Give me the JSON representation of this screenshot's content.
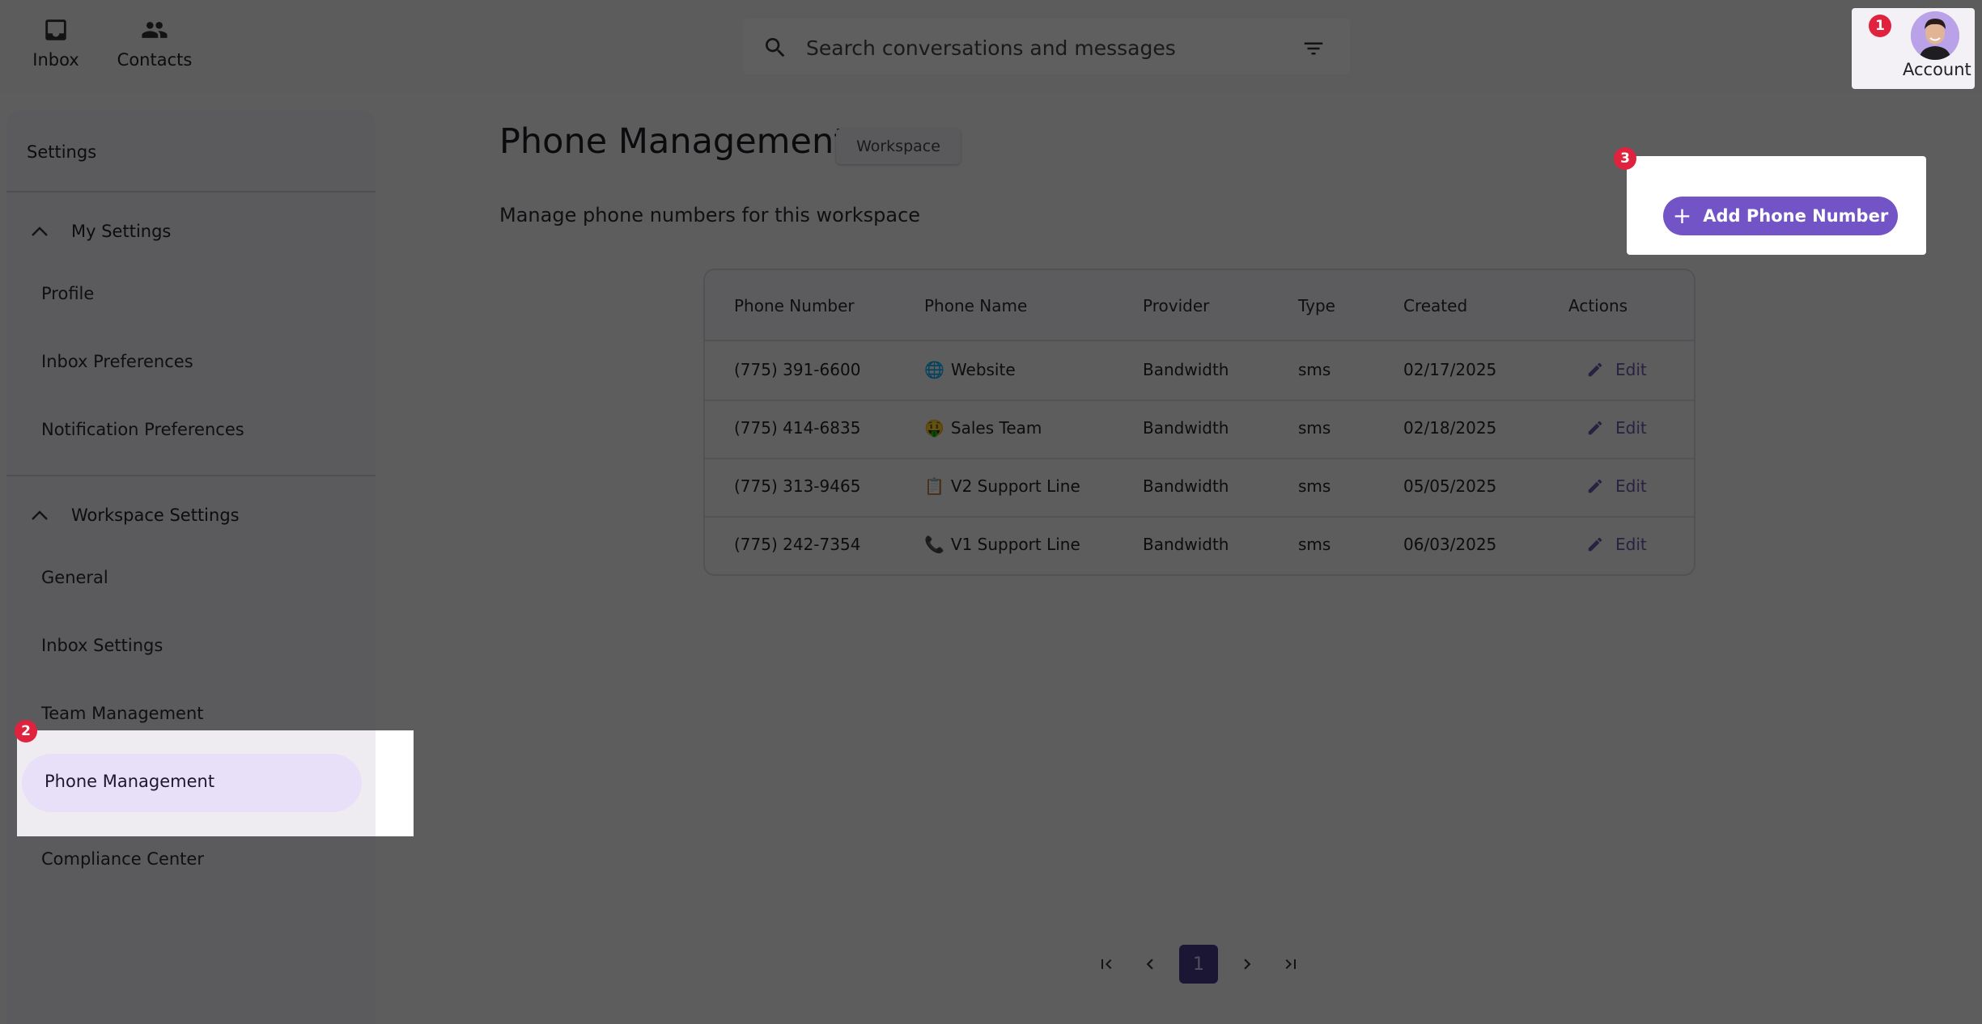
{
  "nav": {
    "items": [
      {
        "label": "Inbox",
        "icon": "inbox-icon"
      },
      {
        "label": "Contacts",
        "icon": "contacts-icon"
      }
    ],
    "account_label": "Account"
  },
  "search": {
    "placeholder": "Search conversations and messages",
    "filter_icon": "filter-icon",
    "search_icon": "search-icon"
  },
  "sidebar": {
    "title": "Settings",
    "sections": [
      {
        "label": "My Settings",
        "items": [
          "Profile",
          "Inbox Preferences",
          "Notification Preferences"
        ]
      },
      {
        "label": "Workspace Settings",
        "items": [
          "General",
          "Inbox Settings",
          "Team Management",
          "Phone Management",
          "Compliance Center"
        ]
      }
    ],
    "active_item": "Phone Management"
  },
  "main": {
    "title": "Phone Management",
    "chip": "Workspace",
    "subtitle": "Manage phone numbers for this workspace",
    "add_button": "Add Phone Number"
  },
  "table": {
    "columns": [
      "Phone Number",
      "Phone Name",
      "Provider",
      "Type",
      "Created",
      "Actions"
    ],
    "rows": [
      {
        "number": "(775) 391-6600",
        "emoji": "🌐",
        "name": "Website",
        "provider": "Bandwidth",
        "type": "sms",
        "created": "02/17/2025",
        "action": "Edit"
      },
      {
        "number": "(775) 414-6835",
        "emoji": "🤑",
        "name": "Sales Team",
        "provider": "Bandwidth",
        "type": "sms",
        "created": "02/18/2025",
        "action": "Edit"
      },
      {
        "number": "(775) 313-9465",
        "emoji": "📋",
        "name": "V2 Support Line",
        "provider": "Bandwidth",
        "type": "sms",
        "created": "05/05/2025",
        "action": "Edit"
      },
      {
        "number": "(775) 242-7354",
        "emoji": "📞",
        "name": "V1 Support Line",
        "provider": "Bandwidth",
        "type": "sms",
        "created": "06/03/2025",
        "action": "Edit"
      }
    ]
  },
  "pagination": {
    "current": "1"
  },
  "annotations": {
    "account": "1",
    "phone_management": "2",
    "add_phone": "3"
  },
  "colors": {
    "accent": "#7354c7",
    "badge": "#e0223e",
    "active_bg": "#e7e0f8"
  }
}
